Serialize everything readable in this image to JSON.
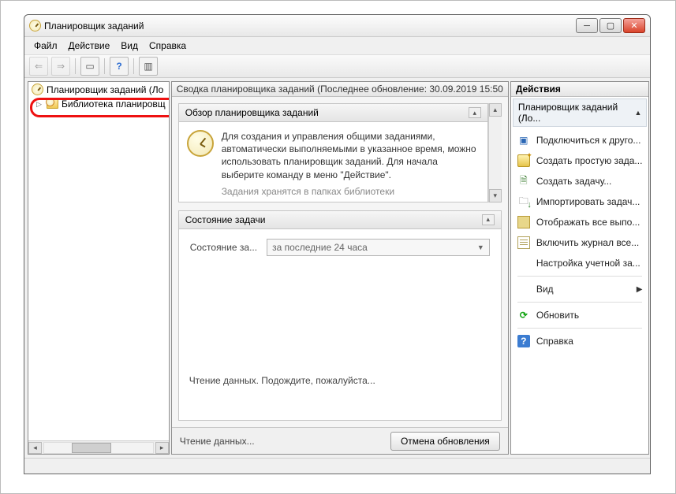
{
  "window": {
    "title": "Планировщик заданий"
  },
  "menu": {
    "file": "Файл",
    "action": "Действие",
    "view": "Вид",
    "help": "Справка"
  },
  "toolbar_icons": {
    "back": "⇐",
    "forward": "⇒",
    "up": "⤒",
    "props": "▭",
    "help": "?",
    "panes": "▥"
  },
  "tree": {
    "root": "Планировщик заданий (Ло",
    "library": "Библиотека планировщ"
  },
  "center": {
    "summary_head": "Сводка планировщика заданий (Последнее обновление: 30.09.2019 15:50",
    "overview_head": "Обзор планировщика заданий",
    "overview_text": "Для создания и управления общими заданиями, автоматически выполняемыми в указанное время, можно использовать планировщик заданий. Для начала выберите команду в меню \"Действие\".",
    "overview_sub": "Задания хранятся в папках библиотеки",
    "status_head": "Состояние задачи",
    "status_label": "Состояние за...",
    "status_combo": "за последние 24 часа",
    "reading": "Чтение данных. Подождите, пожалуйста...",
    "footer_left": "Чтение данных...",
    "cancel_btn": "Отмена обновления"
  },
  "right": {
    "head": "Действия",
    "sub": "Планировщик заданий (Ло...",
    "items": {
      "connect": "Подключиться к друго...",
      "wizard": "Создать простую зада...",
      "create": "Создать задачу...",
      "import": "Импортировать задач...",
      "display": "Отображать все выпо...",
      "log": "Включить журнал все...",
      "account": "Настройка учетной за...",
      "view": "Вид",
      "refresh": "Обновить",
      "help": "Справка"
    }
  }
}
